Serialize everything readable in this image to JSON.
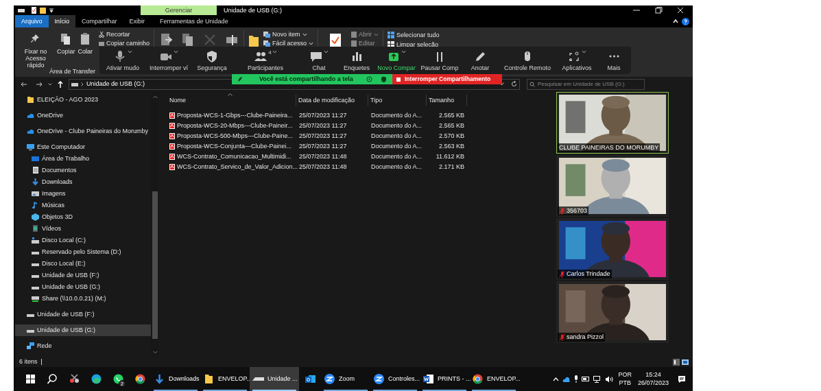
{
  "title_bar": {
    "context_tab": "Gerenciar",
    "title": "Unidade de USB (G:)"
  },
  "ribbon_tabs": [
    {
      "label": "Arquivo",
      "kind": "file",
      "selected": false
    },
    {
      "label": "Início",
      "kind": "tab",
      "selected": true
    },
    {
      "label": "Compartilhar",
      "kind": "tab",
      "selected": false
    },
    {
      "label": "Exibir",
      "kind": "tab",
      "selected": false
    },
    {
      "label": "Ferramentas de Unidade",
      "kind": "tab",
      "selected": false
    }
  ],
  "ribbon": {
    "pin": "Fixar no Acesso rápido",
    "copy": "Copiar",
    "paste": "Colar",
    "cut": "Recortar",
    "copy_path": "Copiar caminho",
    "clipboard_group": "Área de Transfer",
    "new_item": "Novo item",
    "easy_access": "Fácil acesso",
    "open": "Abrir",
    "edit": "Editar",
    "select_all": "Selecionar tudo",
    "clear_selection": "Limpar seleção"
  },
  "meeting_toolbar": [
    {
      "label": "Ativar mudo",
      "kind": "mic",
      "menu": true
    },
    {
      "label": "Interromper ví",
      "kind": "video",
      "menu": true
    },
    {
      "label": "Segurança",
      "kind": "shield",
      "menu": false
    },
    {
      "label": "Participantes",
      "kind": "people",
      "menu": true,
      "badge": "4"
    },
    {
      "label": "Chat",
      "kind": "chat",
      "menu": true
    },
    {
      "label": "Enquetes",
      "kind": "poll",
      "menu": false
    },
    {
      "label": "Novo Compar",
      "kind": "share",
      "menu": true
    },
    {
      "label": "Pausar Comp",
      "kind": "pause",
      "menu": false
    },
    {
      "label": "Anotar",
      "kind": "pen",
      "menu": false
    },
    {
      "label": "Controle Remoto",
      "kind": "mouse",
      "menu": false
    },
    {
      "label": "Aplicativos",
      "kind": "apps",
      "menu": true
    },
    {
      "label": "Mais",
      "kind": "more",
      "menu": false
    }
  ],
  "share_banner": {
    "status": "Você está compartilhando a tela",
    "stop": "Interromper Compartilhamento"
  },
  "address_bar": {
    "path": "Unidade de USB (G:)",
    "search_placeholder": "Pesquisar em Unidade de USB (G:)"
  },
  "navigation": [
    {
      "label": "ELEIÇÃO - AGO 2023",
      "kind": "folder",
      "selected": false
    },
    {
      "label": "OneDrive",
      "kind": "cloud",
      "selected": false
    },
    {
      "label": "OneDrive - Clube Paineiras do Morumby",
      "kind": "cloud",
      "selected": false
    },
    {
      "label": "Este Computador",
      "kind": "pc",
      "selected": false,
      "children": [
        {
          "label": "Área de Trabalho",
          "kind": "desktop",
          "selected": false
        },
        {
          "label": "Documentos",
          "kind": "docs",
          "selected": false
        },
        {
          "label": "Downloads",
          "kind": "download",
          "selected": false
        },
        {
          "label": "Imagens",
          "kind": "images",
          "selected": false
        },
        {
          "label": "Músicas",
          "kind": "music",
          "selected": false
        },
        {
          "label": "Objetos 3D",
          "kind": "cube",
          "selected": false
        },
        {
          "label": "Vídeos",
          "kind": "film",
          "selected": false
        },
        {
          "label": "Disco Local (C:)",
          "kind": "system_drive",
          "selected": false
        },
        {
          "label": "Reservado pelo Sistema (D:)",
          "kind": "drive",
          "selected": false
        },
        {
          "label": "Disco Local (E:)",
          "kind": "drive",
          "selected": false
        },
        {
          "label": "Unidade de USB (F:)",
          "kind": "drive",
          "selected": false
        },
        {
          "label": "Unidade de USB (G:)",
          "kind": "drive",
          "selected": false
        },
        {
          "label": "Share (\\\\10.0.0.21) (M:)",
          "kind": "net_drive",
          "selected": false
        }
      ]
    },
    {
      "label": "Unidade de USB (F:)",
      "kind": "drive",
      "selected": false
    },
    {
      "label": "Unidade de USB (G:)",
      "kind": "drive",
      "selected": true
    },
    {
      "label": "Rede",
      "kind": "network",
      "selected": false
    }
  ],
  "files": {
    "columns": [
      "Nome",
      "Data de modificação",
      "Tipo",
      "Tamanho"
    ],
    "rows": [
      {
        "name": "Proposta-WCS-1-Gbps---Clube-Paineira...",
        "modified": "25/07/2023 11:27",
        "type": "Documento do A...",
        "size": "2.565 KB"
      },
      {
        "name": "Proposta-WCS-20-Mbps---Clube-Paineir...",
        "modified": "25/07/2023 11:27",
        "type": "Documento do A...",
        "size": "2.565 KB"
      },
      {
        "name": "Proposta-WCS-500-Mbps---Clube-Paine...",
        "modified": "25/07/2023 11:27",
        "type": "Documento do A...",
        "size": "2.570 KB"
      },
      {
        "name": "Proposta-WCS-Conjunta---Clube-Painei...",
        "modified": "25/07/2023 11:27",
        "type": "Documento do A...",
        "size": "2.563 KB"
      },
      {
        "name": "WCS-Contrato_Comunicacao_Multimidi...",
        "modified": "25/07/2023 11:48",
        "type": "Documento do A...",
        "size": "11.612 KB"
      },
      {
        "name": "WCS-Contrato_Servico_de_Valor_Adicion...",
        "modified": "25/07/2023 11:48",
        "type": "Documento do A...",
        "size": "2.171 KB"
      }
    ]
  },
  "status_bar": {
    "count": "6 itens"
  },
  "video_tiles": [
    {
      "name": "CLUBE PAINEIRAS DO MORUMBY",
      "muted": false,
      "active": true
    },
    {
      "name": "356703",
      "muted": true,
      "active": false
    },
    {
      "name": "Carlos Trindade",
      "muted": true,
      "active": false
    },
    {
      "name": "sandra Pizzol",
      "muted": true,
      "active": false
    }
  ],
  "taskbar": [
    {
      "kind": "start",
      "active": false
    },
    {
      "kind": "search",
      "active": false
    },
    {
      "kind": "snip",
      "active": false
    },
    {
      "kind": "edge",
      "active": false
    },
    {
      "kind": "whatsapp",
      "active": false,
      "badge": "2"
    },
    {
      "kind": "chrome",
      "active": false
    },
    {
      "kind": "download",
      "label": "Downloads",
      "active": false
    },
    {
      "kind": "folder",
      "label": "ENVELOP...",
      "active": false
    },
    {
      "kind": "drive",
      "label": "Unidade ...",
      "active": true
    },
    {
      "kind": "outlook",
      "active": false
    },
    {
      "kind": "zoom",
      "label": "Zoom",
      "active": false
    },
    {
      "kind": "zoom",
      "label": "Controles...",
      "active": false
    },
    {
      "kind": "word",
      "label": "PRINTS - ...",
      "active": false
    },
    {
      "kind": "chrome",
      "label": "ENVELOP...",
      "active": false
    }
  ],
  "tray": {
    "language": "POR",
    "layout": "PTB",
    "time": "15:24",
    "date": "26/07/2023"
  }
}
